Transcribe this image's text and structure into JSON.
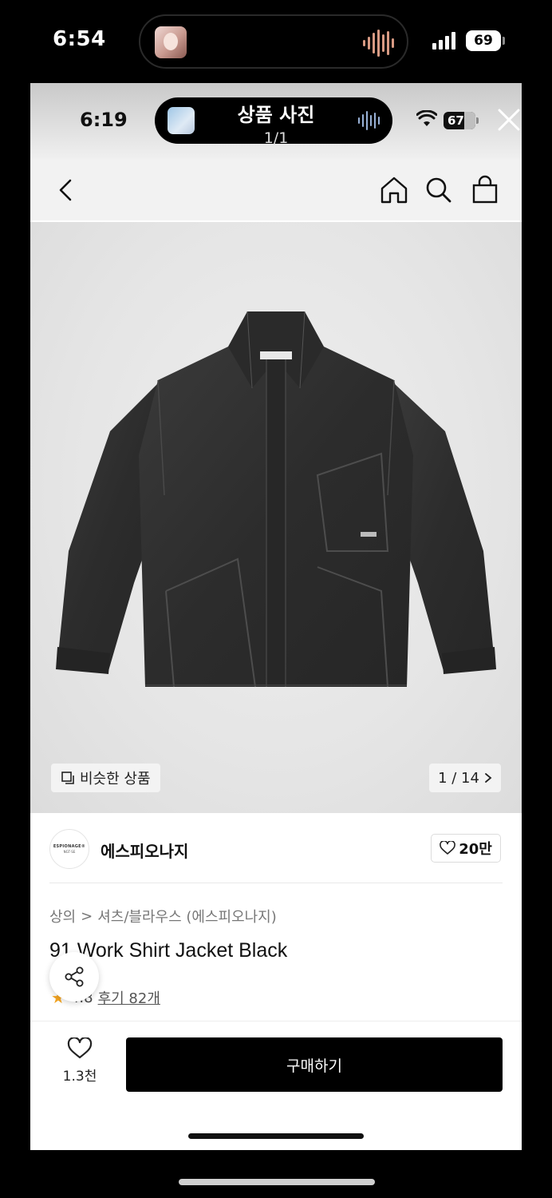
{
  "outer_status": {
    "time": "6:54",
    "battery": "69"
  },
  "inner_status": {
    "time": "6:19",
    "battery": "67"
  },
  "viewer": {
    "title": "상품 사진",
    "counter": "1/1"
  },
  "photo": {
    "similar_label": "비슷한 상품",
    "page_indicator": "1 / 14"
  },
  "brand": {
    "name": "에스피오나지",
    "logo_line1": "ESPIONAGE®",
    "logo_line2": "NGT·SE",
    "likes": "20만"
  },
  "breadcrumb": {
    "category": "상의",
    "separator": ">",
    "subcategory": "셔츠/블라우스 (에스피오나지)"
  },
  "product": {
    "title": "91 Work Shirt Jacket Black",
    "rating": "4.8",
    "reviews": "후기 82개"
  },
  "bottom": {
    "wish_count": "1.3천",
    "buy_label": "구매하기"
  },
  "icons": [
    "back-icon",
    "home-icon",
    "search-icon",
    "bag-icon",
    "close-icon",
    "heart-icon",
    "share-icon",
    "star-icon",
    "similar-icon",
    "chevron-right-icon",
    "wifi-icon",
    "signal-icon",
    "battery-icon",
    "soundwave-icon"
  ]
}
